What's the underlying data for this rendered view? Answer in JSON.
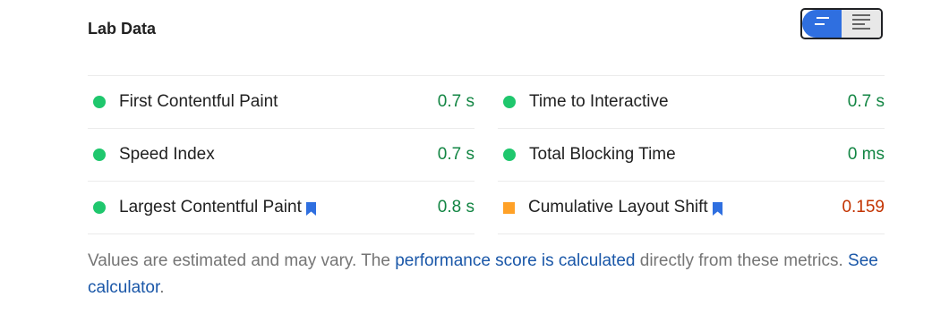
{
  "section": {
    "title": "Lab Data"
  },
  "view_toggle": {
    "active_icon": "summary-view-icon",
    "inactive_icon": "detailed-view-icon"
  },
  "metrics": {
    "left": [
      {
        "label": "First Contentful Paint",
        "value": "0.7 s",
        "status": "pass",
        "bookmark": false
      },
      {
        "label": "Speed Index",
        "value": "0.7 s",
        "status": "pass",
        "bookmark": false
      },
      {
        "label": "Largest Contentful Paint",
        "value": "0.8 s",
        "status": "pass",
        "bookmark": true
      }
    ],
    "right": [
      {
        "label": "Time to Interactive",
        "value": "0.7 s",
        "status": "pass",
        "bookmark": false
      },
      {
        "label": "Total Blocking Time",
        "value": "0 ms",
        "status": "pass",
        "bookmark": false
      },
      {
        "label": "Cumulative Layout Shift",
        "value": "0.159",
        "status": "average",
        "bookmark": true
      }
    ]
  },
  "footer": {
    "text_before": "Values are estimated and may vary. The ",
    "link_score": "performance score is calculated",
    "text_after": " directly from these metrics. ",
    "link_calculator": "See calculator",
    "text_end": "."
  },
  "colors": {
    "pass": "#1fc76d",
    "pass_value": "#128543",
    "average": "#ffa127",
    "average_value": "#c33300",
    "link": "#1a57a8",
    "toggle_active": "#2f6fe0",
    "bookmark": "#2f6fe0"
  }
}
